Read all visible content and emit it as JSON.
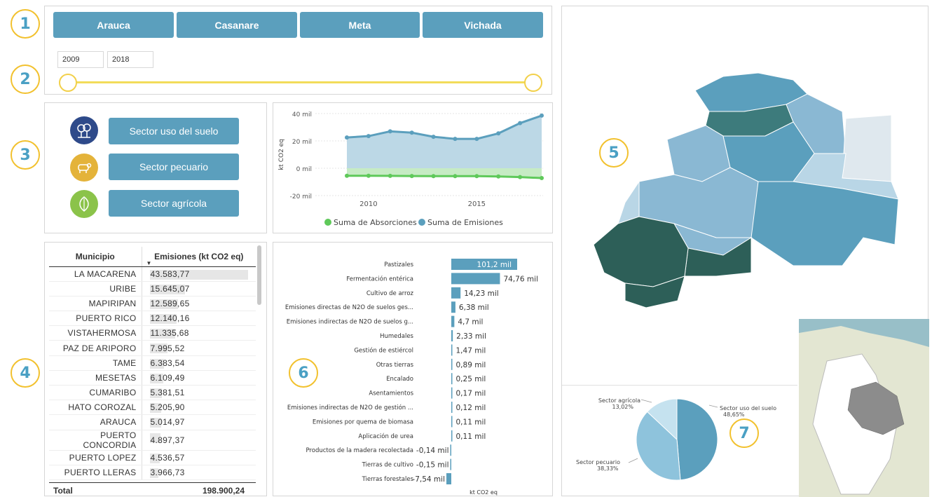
{
  "badges": [
    "1",
    "2",
    "3",
    "4",
    "5",
    "6",
    "7"
  ],
  "departments": [
    "Arauca",
    "Casanare",
    "Meta",
    "Vichada"
  ],
  "year_range": {
    "start": "2009",
    "end": "2018"
  },
  "sectors": [
    {
      "label": "Sector uso del suelo",
      "icon": "forest-icon",
      "color": "#2e4a8a"
    },
    {
      "label": "Sector pecuario",
      "icon": "cow-icon",
      "color": "#e4b33a"
    },
    {
      "label": "Sector agrícola",
      "icon": "leaf-icon",
      "color": "#8bc34a"
    }
  ],
  "line_chart": {
    "ylabel": "kt CO2 eq",
    "yticks": [
      "40 mil",
      "20 mil",
      "0 mil",
      "-20 mil"
    ],
    "xticks": [
      "2010",
      "2015"
    ],
    "legend": [
      "Suma de Absorciones",
      "Suma de Emisiones"
    ],
    "colors": {
      "absorciones": "#5fc95a",
      "emisiones": "#5b9fbd"
    }
  },
  "table": {
    "col_municipio": "Municipio",
    "col_emisiones": "Emisiones (kt CO2 eq)",
    "rows": [
      {
        "name": "LA MACARENA",
        "value": "43.583,77"
      },
      {
        "name": "URIBE",
        "value": "15.645,07"
      },
      {
        "name": "MAPIRIPAN",
        "value": "12.589,65"
      },
      {
        "name": "PUERTO RICO",
        "value": "12.140,16"
      },
      {
        "name": "VISTAHERMOSA",
        "value": "11.335,68"
      },
      {
        "name": "PAZ DE ARIPORO",
        "value": "7.995,52"
      },
      {
        "name": "TAME",
        "value": "6.383,54"
      },
      {
        "name": "MESETAS",
        "value": "6.109,49"
      },
      {
        "name": "CUMARIBO",
        "value": "5.381,51"
      },
      {
        "name": "HATO COROZAL",
        "value": "5.205,90"
      },
      {
        "name": "ARAUCA",
        "value": "5.014,97"
      },
      {
        "name": "PUERTO CONCORDIA",
        "value": "4.897,37"
      },
      {
        "name": "PUERTO LOPEZ",
        "value": "4.536,57"
      },
      {
        "name": "PUERTO LLERAS",
        "value": "3.966,73"
      }
    ],
    "total_label": "Total",
    "total_value": "198.900,24"
  },
  "chart_data": [
    {
      "type": "area",
      "x": [
        2009,
        2010,
        2011,
        2012,
        2013,
        2014,
        2015,
        2016,
        2017,
        2018
      ],
      "series": [
        {
          "name": "Suma de Emisiones",
          "values": [
            22.5,
            23.5,
            27,
            26,
            23,
            21.5,
            21.5,
            25.5,
            33,
            38.5
          ]
        },
        {
          "name": "Suma de Absorciones",
          "values": [
            -5.5,
            -5.5,
            -5.6,
            -5.7,
            -5.8,
            -5.8,
            -5.8,
            -6,
            -6.5,
            -7.2
          ]
        }
      ],
      "ylabel": "kt CO2 eq",
      "ylim": [
        -20,
        40
      ],
      "legend": "bottom"
    },
    {
      "type": "bar",
      "orientation": "horizontal",
      "xlabel": "kt CO2 eq",
      "categories": [
        "Pastizales",
        "Fermentación entérica",
        "Cultivo de arroz",
        "Emisiones directas de N2O de suelos ges...",
        "Emisiones indirectas de N2O de suelos g...",
        "Humedales",
        "Gestión de estiércol",
        "Otras tierras",
        "Encalado",
        "Asentamientos",
        "Emisiones indirectas de N2O de gestión ...",
        "Emisiones por quema de biomasa",
        "Aplicación de urea",
        "Productos de la madera recolectada",
        "Tierras de cultivo",
        "Tierras forestales"
      ],
      "values": [
        101.2,
        74.76,
        14.23,
        6.38,
        4.7,
        2.33,
        1.47,
        0.89,
        0.25,
        0.17,
        0.12,
        0.11,
        0.11,
        -0.14,
        -0.15,
        -7.54
      ],
      "labels": [
        "101,2 mil",
        "74,76 mil",
        "14,23 mil",
        "6,38 mil",
        "4,7 mil",
        "2,33 mil",
        "1,47 mil",
        "0,89 mil",
        "0,25 mil",
        "0,17 mil",
        "0,12 mil",
        "0,11 mil",
        "0,11 mil",
        "-0,14 mil",
        "-0,15 mil",
        "-7,54 mil"
      ]
    },
    {
      "type": "pie",
      "categories": [
        "Sector uso del suelo",
        "Sector pecuario",
        "Sector agrícola"
      ],
      "values": [
        48.65,
        38.33,
        13.02
      ],
      "labels": [
        "48,65%",
        "38,33%",
        "13,02%"
      ],
      "colors": [
        "#5b9fbd",
        "#8ec3dc",
        "#c5e2ef"
      ]
    }
  ],
  "map_colors": [
    "#2d5f58",
    "#3d7b7c",
    "#5b9fbd",
    "#8ab8d3",
    "#b9d6e6",
    "#dfe8ee"
  ]
}
